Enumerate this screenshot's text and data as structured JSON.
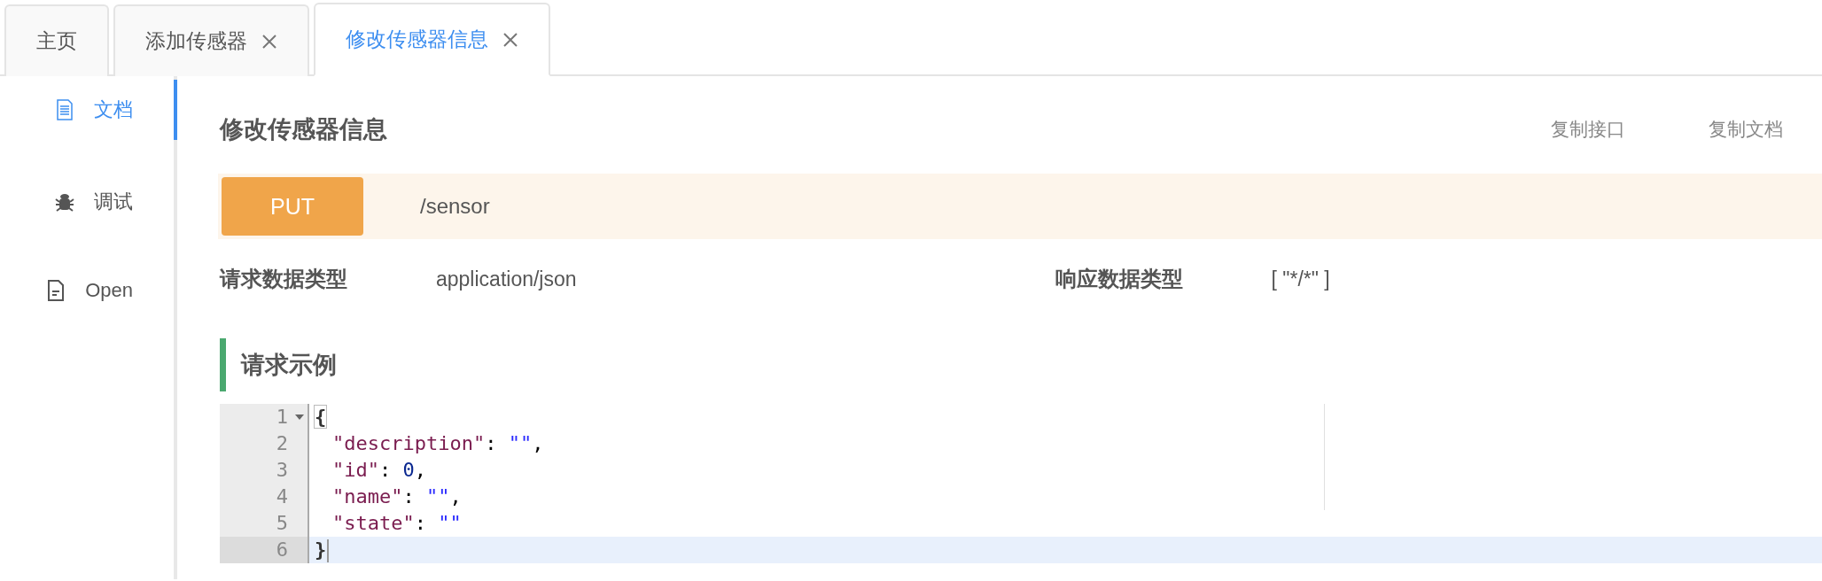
{
  "tabs": [
    {
      "label": "主页",
      "selected": false,
      "closable": false
    },
    {
      "label": "添加传感器",
      "selected": false,
      "closable": true
    },
    {
      "label": "修改传感器信息",
      "selected": true,
      "closable": true
    }
  ],
  "sidebar": {
    "items": [
      {
        "label": "文档",
        "kind": "doc",
        "selected": true
      },
      {
        "label": "调试",
        "kind": "bug",
        "selected": false
      },
      {
        "label": "Open",
        "kind": "file",
        "selected": false
      }
    ]
  },
  "page": {
    "title": "修改传感器信息",
    "actions": [
      "复制接口",
      "复制文档"
    ],
    "method": "PUT",
    "path": "/sensor",
    "request_type_label": "请求数据类型",
    "request_type": "application/json",
    "response_type_label": "响应数据类型",
    "response_type": "[ \"*/*\" ]",
    "section_title": "请求示例"
  },
  "code": {
    "lines": [
      {
        "number": "1",
        "foldable": true,
        "active": false,
        "tokens": [
          {
            "kind": "paren",
            "text": "{",
            "matched": true
          }
        ],
        "children": [
          {
            "number": "2",
            "foldable": false,
            "active": false,
            "tokens": [
              {
                "kind": "key",
                "text": "\"description\""
              },
              {
                "kind": "punct",
                "text": ": "
              },
              {
                "kind": "string",
                "text": "\"\""
              },
              {
                "kind": "punct",
                "text": ","
              }
            ]
          },
          {
            "number": "3",
            "foldable": false,
            "active": false,
            "tokens": [
              {
                "kind": "key",
                "text": "\"id\""
              },
              {
                "kind": "punct",
                "text": ": "
              },
              {
                "kind": "number",
                "text": "0"
              },
              {
                "kind": "punct",
                "text": ","
              }
            ]
          },
          {
            "number": "4",
            "foldable": false,
            "active": false,
            "tokens": [
              {
                "kind": "key",
                "text": "\"name\""
              },
              {
                "kind": "punct",
                "text": ": "
              },
              {
                "kind": "string",
                "text": "\"\""
              },
              {
                "kind": "punct",
                "text": ","
              }
            ]
          },
          {
            "number": "5",
            "foldable": false,
            "active": false,
            "tokens": [
              {
                "kind": "key",
                "text": "\"state\""
              },
              {
                "kind": "punct",
                "text": ": "
              },
              {
                "kind": "string",
                "text": "\"\""
              }
            ]
          }
        ]
      },
      {
        "number": "6",
        "foldable": false,
        "active": true,
        "tokens": [
          {
            "kind": "paren",
            "text": "}",
            "matched": false
          }
        ]
      }
    ]
  }
}
